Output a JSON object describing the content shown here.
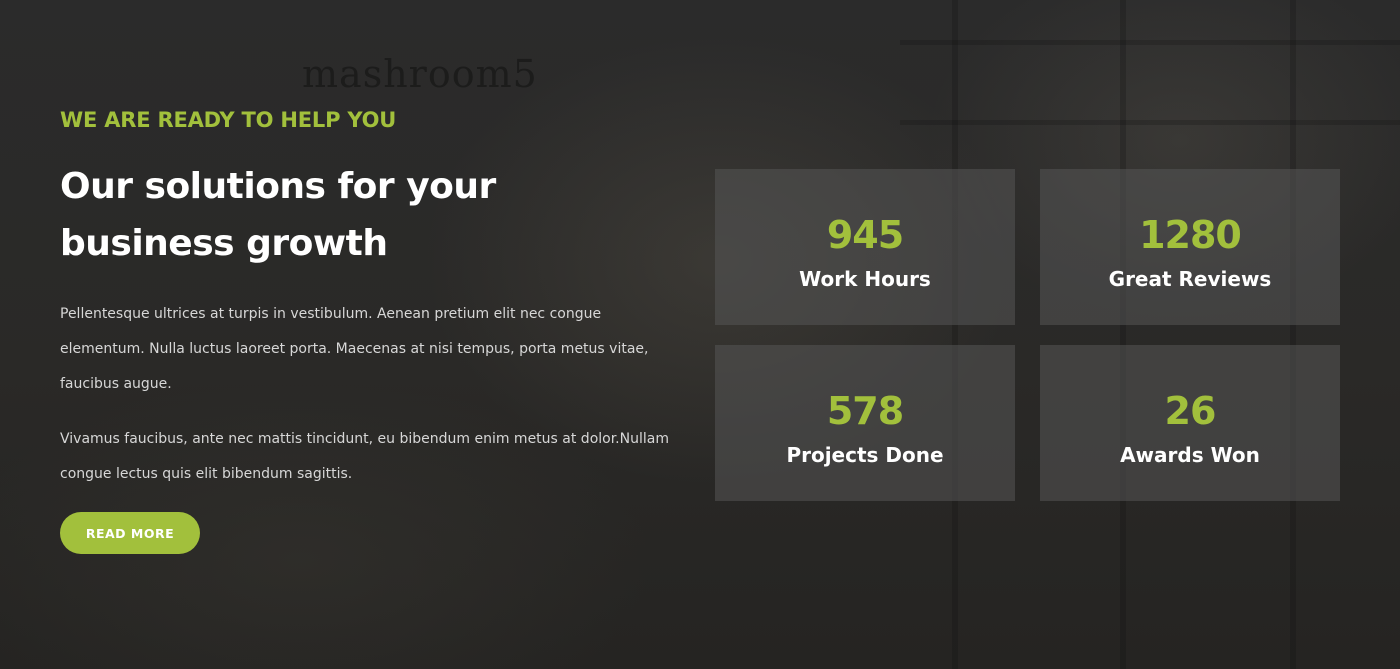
{
  "background": {
    "watermark_text": "mashroom5"
  },
  "section": {
    "eyebrow": "WE ARE READY TO HELP YOU",
    "headline": "Our solutions for your business growth",
    "paragraphs": [
      "Pellentesque ultrices at turpis in vestibulum. Aenean pretium elit nec congue elementum. Nulla luctus laoreet porta. Maecenas at nisi tempus, porta metus vitae, faucibus augue.",
      "Vivamus faucibus, ante nec mattis tincidunt, eu bibendum enim metus at dolor.Nullam congue lectus quis elit bibendum sagittis."
    ],
    "cta_label": "READ MORE"
  },
  "stats": [
    {
      "value": "945",
      "label": "Work Hours"
    },
    {
      "value": "1280",
      "label": "Great Reviews"
    },
    {
      "value": "578",
      "label": "Projects Done"
    },
    {
      "value": "26",
      "label": "Awards Won"
    }
  ],
  "colors": {
    "accent": "#a2c03c",
    "background": "#262626",
    "card": "#555555",
    "text": "#ffffff",
    "body_text": "#d7d7d7"
  }
}
